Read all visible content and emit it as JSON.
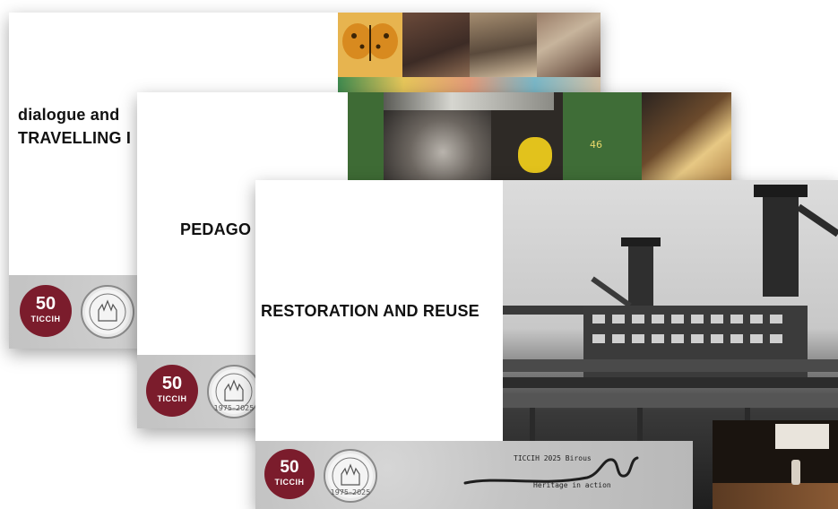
{
  "slides": [
    {
      "title_line1": "dialogue and",
      "title_line2": "TRAVELLING I",
      "logo": {
        "number": "50",
        "name": "TICCIH"
      }
    },
    {
      "title": "PEDAGO",
      "logo": {
        "number": "50",
        "name": "TICCIH"
      },
      "seal_years": "1975–2025",
      "photo_sign": "46"
    },
    {
      "title": "RESTORATION AND REUSE",
      "logo": {
        "number": "50",
        "name": "TICCIH"
      },
      "seal_years": "1975–2025",
      "watermark": {
        "line1": "TICCIH 2025 Birous",
        "line2": "Heritage in action"
      }
    }
  ],
  "colors": {
    "logo_red": "#7b1c2c",
    "footer_grey": "#c4c4c4",
    "title_text": "#111111",
    "welder_green": "#3e6b35"
  }
}
